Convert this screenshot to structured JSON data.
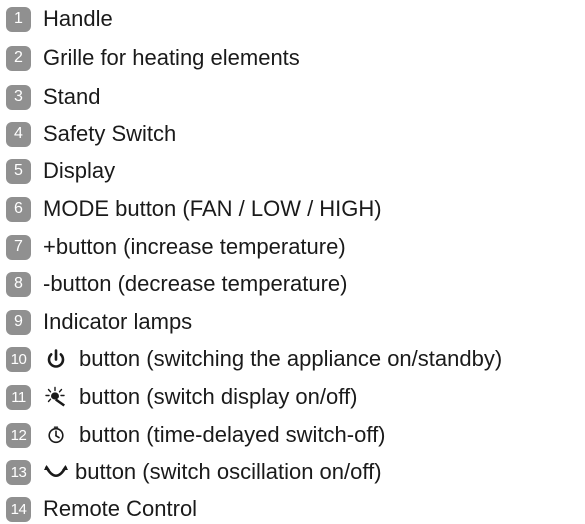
{
  "legend": {
    "items": [
      {
        "number": "1",
        "label": "Handle"
      },
      {
        "number": "2",
        "label": "Grille for heating elements"
      },
      {
        "number": "3",
        "label": "Stand"
      },
      {
        "number": "4",
        "label": "Safety Switch"
      },
      {
        "number": "5",
        "label": "Display"
      },
      {
        "number": "6",
        "label": "MODE button (FAN / LOW / HIGH)"
      },
      {
        "number": "7",
        "label": "+button (increase temperature)"
      },
      {
        "number": "8",
        "label": "-button (decrease temperature)"
      },
      {
        "number": "9",
        "label": "Indicator lamps"
      },
      {
        "number": "10",
        "icon": "power-icon",
        "label": "button (switching the appliance on/standby)"
      },
      {
        "number": "11",
        "icon": "light-icon",
        "label": "button (switch display on/off)"
      },
      {
        "number": "12",
        "icon": "timer-icon",
        "label": "button (time-delayed switch-off)"
      },
      {
        "number": "13",
        "icon": "oscillation-icon",
        "label": "button (switch oscillation on/off)"
      },
      {
        "number": "14",
        "label": "Remote Control"
      }
    ]
  },
  "colors": {
    "badge": "#909090",
    "text": "#1a1a1a"
  }
}
